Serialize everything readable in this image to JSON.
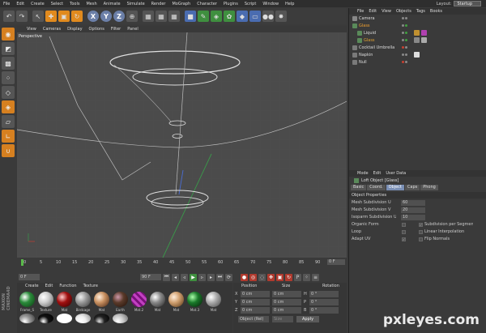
{
  "menubar": {
    "items": [
      "File",
      "Edit",
      "Create",
      "Select",
      "Tools",
      "Mesh",
      "Animate",
      "Simulate",
      "Render",
      "MoGraph",
      "Character",
      "Plugins",
      "Script",
      "Window",
      "Help"
    ],
    "layout_label": "Layout:",
    "layout_value": "Startup"
  },
  "toolbar": {
    "axis": [
      "X",
      "Y",
      "Z"
    ]
  },
  "viewport": {
    "menu": [
      "View",
      "Cameras",
      "Display",
      "Options",
      "Filter",
      "Panel"
    ],
    "label": "Perspective"
  },
  "timeline": {
    "ticks": [
      "0",
      "5",
      "10",
      "15",
      "20",
      "25",
      "30",
      "35",
      "40",
      "45",
      "50",
      "55",
      "60",
      "65",
      "70",
      "75",
      "80",
      "85",
      "90"
    ],
    "frame": "0 F"
  },
  "transport": {
    "start": "0 F",
    "end": "90 F"
  },
  "materials": {
    "menu": [
      "Create",
      "Edit",
      "Function",
      "Texture"
    ],
    "row1": [
      "Frame_S",
      "Texture",
      "Mat",
      "Birdcage",
      "Mat",
      "Earth",
      "Mat.2",
      "Mat",
      "Mat",
      "Mat.3",
      "Mat"
    ],
    "brand": "MAXON CINEMA4D"
  },
  "coords": {
    "headers": [
      "Position",
      "Size",
      "Rotation"
    ],
    "rows": [
      {
        "a": "X",
        "p": "0 cm",
        "s": "0 cm",
        "r": "H",
        "rv": "0 °"
      },
      {
        "a": "Y",
        "p": "0 cm",
        "s": "0 cm",
        "r": "P",
        "rv": "0 °"
      },
      {
        "a": "Z",
        "p": "0 cm",
        "s": "0 cm",
        "r": "B",
        "rv": "0 °"
      }
    ],
    "mode": "Object (Rel)",
    "size_mode": "Size",
    "apply": "Apply"
  },
  "objects": {
    "menu": [
      "File",
      "Edit",
      "View",
      "Objects",
      "Tags",
      "Books"
    ],
    "items": [
      {
        "name": "Camera",
        "active": false
      },
      {
        "name": "Glass",
        "active": true
      },
      {
        "name": "Liquid",
        "active": false
      },
      {
        "name": "Glass",
        "active": false
      },
      {
        "name": "Cocktail Umbrella",
        "active": false
      },
      {
        "name": "Napkin",
        "active": false
      },
      {
        "name": "Null",
        "active": false
      }
    ]
  },
  "attributes": {
    "menu": [
      "Mode",
      "Edit",
      "User Data"
    ],
    "title": "Loft Object [Glass]",
    "tabs": [
      "Basic",
      "Coord.",
      "Object",
      "Caps",
      "Phong"
    ],
    "section": "Object Properties",
    "fields": [
      {
        "label": "Mesh Subdivision U",
        "value": "60"
      },
      {
        "label": "Mesh Subdivision V",
        "value": "20"
      },
      {
        "label": "Isoparm Subdivision U",
        "value": "10"
      }
    ],
    "checks": [
      {
        "left": "Organic Form",
        "lv": "",
        "right": "Subdivision per Segment",
        "rv": "✓"
      },
      {
        "left": "Loop",
        "lv": "",
        "right": "Linear Interpolation",
        "rv": ""
      },
      {
        "left": "Adapt UV",
        "lv": "✓",
        "right": "Flip Normals",
        "rv": ""
      }
    ]
  },
  "watermark": "pxleyes.com"
}
